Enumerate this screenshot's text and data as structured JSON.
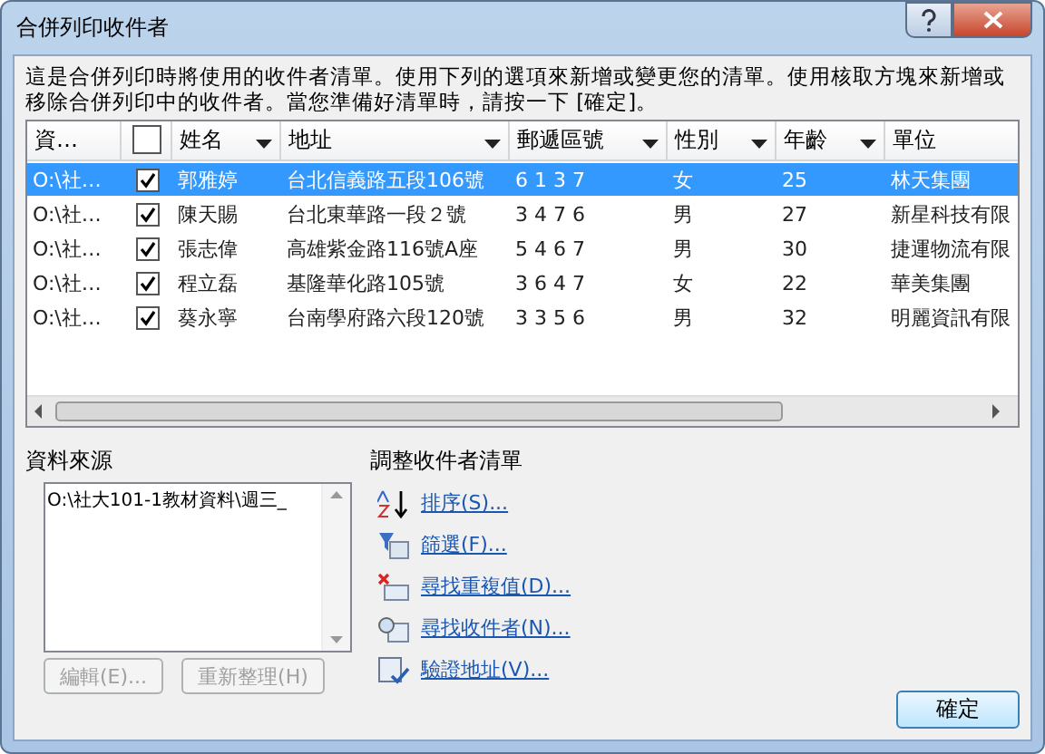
{
  "window": {
    "title": "合併列印收件者"
  },
  "description": "這是合併列印時將使用的收件者清單。使用下列的選項來新增或變更您的清單。使用核取方塊來新增或移除合併列印中的收件者。當您準備好清單時，請按一下 [確定]。",
  "table": {
    "select_all": {
      "checked": false
    },
    "columns": [
      {
        "label": "資…",
        "kind": "text",
        "sortable": false
      },
      {
        "label": "姓名",
        "kind": "text",
        "sortable": true
      },
      {
        "label": "地址",
        "kind": "text",
        "sortable": true
      },
      {
        "label": "郵遞區號",
        "kind": "text",
        "sortable": true
      },
      {
        "label": "性別",
        "kind": "text",
        "sortable": true
      },
      {
        "label": "年齡",
        "kind": "text",
        "sortable": true
      },
      {
        "label": "單位",
        "kind": "text",
        "sortable": false
      }
    ],
    "rows": [
      {
        "selected": true,
        "checked": true,
        "cells": [
          "O:\\社…",
          "郭雅婷",
          "台北信義路五段106號",
          "6 1 3 7",
          "女",
          "25",
          "林天集團"
        ]
      },
      {
        "selected": false,
        "checked": true,
        "cells": [
          "O:\\社…",
          "陳天賜",
          "台北東華路一段２號",
          "3 4 7 6",
          "男",
          "27",
          "新星科技有限"
        ]
      },
      {
        "selected": false,
        "checked": true,
        "cells": [
          "O:\\社…",
          "張志偉",
          "高雄紫金路116號A座",
          "5 4 6 7",
          "男",
          "30",
          "捷運物流有限"
        ]
      },
      {
        "selected": false,
        "checked": true,
        "cells": [
          "O:\\社…",
          "程立磊",
          "基隆華化路105號",
          "3 6 4 7",
          "女",
          "22",
          "華美集團"
        ]
      },
      {
        "selected": false,
        "checked": true,
        "cells": [
          "O:\\社…",
          "葵永寧",
          "台南學府路六段120號",
          "3 3 5 6",
          "男",
          "32",
          "明麗資訊有限"
        ]
      }
    ]
  },
  "data_source": {
    "label": "資料來源",
    "items": [
      "O:\\社大101-1教材資料\\週三_"
    ],
    "buttons": [
      {
        "label": "編輯(E)...",
        "disabled": true
      },
      {
        "label": "重新整理(H)",
        "disabled": true
      }
    ]
  },
  "refine": {
    "label": "調整收件者清單",
    "links": [
      {
        "kind": "sort",
        "label": "排序(S)..."
      },
      {
        "kind": "filter",
        "label": "篩選(F)..."
      },
      {
        "kind": "duplicates",
        "label": "尋找重複值(D)..."
      },
      {
        "kind": "find",
        "label": "尋找收件者(N)..."
      },
      {
        "kind": "validate",
        "label": "驗證地址(V)..."
      }
    ]
  },
  "ok_button": "確定"
}
